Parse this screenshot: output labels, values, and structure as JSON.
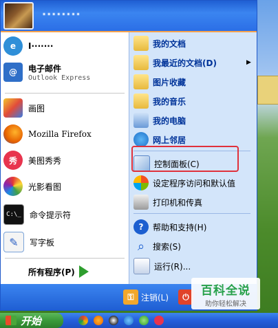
{
  "user": {
    "name": "········"
  },
  "left_pane": {
    "pinned": [
      {
        "label": "I·······",
        "sub": ""
      },
      {
        "label": "电子邮件",
        "sub": "Outlook Express"
      }
    ],
    "recent": [
      {
        "label": "画图"
      },
      {
        "label": "Mozilla Firefox"
      },
      {
        "label": "美图秀秀"
      },
      {
        "label": "光影看图"
      },
      {
        "label": "命令提示符"
      },
      {
        "label": "写字板"
      }
    ],
    "all_programs_label": "所有程序(P)"
  },
  "right_pane": {
    "items": [
      {
        "label": "我的文档",
        "bold": true
      },
      {
        "label": "我最近的文档(D)",
        "bold": true
      },
      {
        "label": "图片收藏",
        "bold": true
      },
      {
        "label": "我的音乐",
        "bold": true
      },
      {
        "label": "我的电脑",
        "bold": true
      },
      {
        "label": "网上邻居",
        "bold": true
      },
      {
        "label": "控制面板(C)",
        "bold": false
      },
      {
        "label": "设定程序访问和默认值",
        "bold": false
      },
      {
        "label": "打印机和传真",
        "bold": false
      },
      {
        "label": "帮助和支持(H)",
        "bold": false
      },
      {
        "label": "搜索(S)",
        "bold": false
      },
      {
        "label": "运行(R)...",
        "bold": false
      }
    ],
    "submenu_arrow": "▶"
  },
  "footer": {
    "logoff_label": "注销(L)",
    "shutdown_label": ""
  },
  "taskbar": {
    "start_label": "开始",
    "quick_launch_icons": [
      "chrome-icon",
      "firefox-icon",
      "qq-icon",
      "ie-icon",
      "messenger-icon",
      "meitu-icon"
    ]
  },
  "watermark": {
    "title": "百科全说",
    "subtitle": "助你轻松解决"
  },
  "colors": {
    "header_blue": "#1f5fd3",
    "right_pane_blue": "#d3e5fa",
    "highlight_red": "#e0303a",
    "start_green": "#3a9a3a",
    "watermark_green": "#27a14a"
  }
}
